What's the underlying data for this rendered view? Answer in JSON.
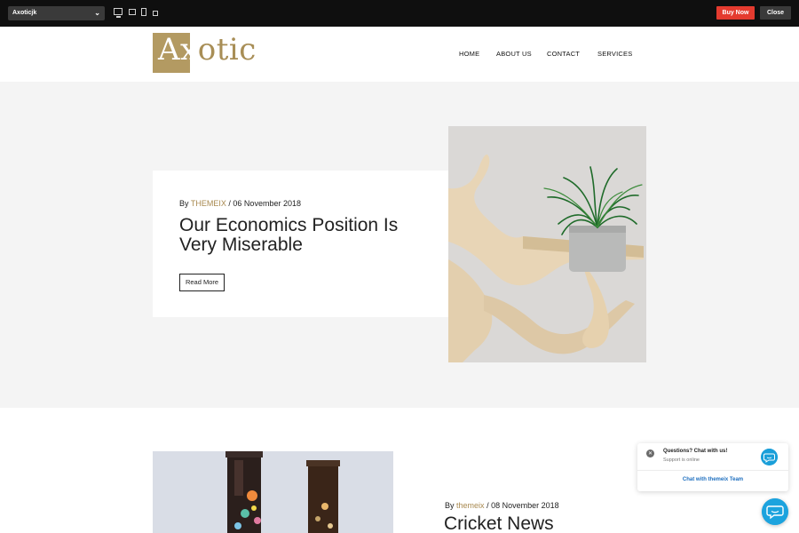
{
  "toolbar": {
    "theme_selector": "Axoticjk",
    "buy_label": "Buy Now",
    "close_label": "Close",
    "devices": [
      "desktop-icon",
      "laptop-icon",
      "tablet-icon",
      "mobile-icon"
    ]
  },
  "site": {
    "logo_text": "Axotic",
    "nav": [
      "HOME",
      "ABOUT US",
      "CONTACT",
      "SERVICES"
    ]
  },
  "posts": [
    {
      "by": "By",
      "author": "THEMEIX",
      "separator": "/",
      "date": "06 November 2018",
      "title": "Our Economics Position Is Very Miserable",
      "read_more": "Read More"
    },
    {
      "by": "By",
      "author": "themeix",
      "separator": "/",
      "date": "08 November 2018",
      "title": "Cricket News"
    }
  ],
  "chat": {
    "question": "Questions? Chat with us!",
    "status": "Support is online",
    "cta": "Chat with themeix Team"
  },
  "colors": {
    "accent": "#a8894f",
    "buy_button": "#e43b2f",
    "chat_blue": "#1ca3de"
  }
}
